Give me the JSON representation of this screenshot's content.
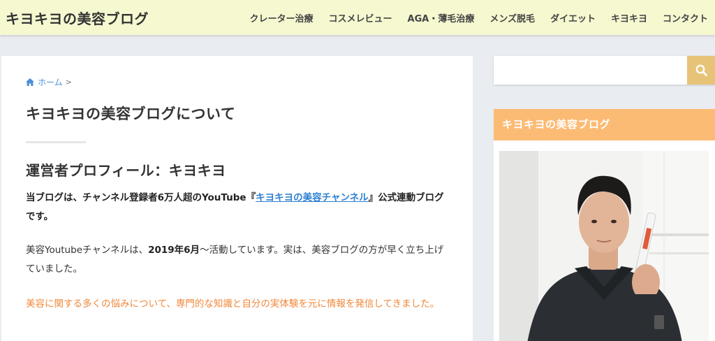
{
  "header": {
    "site_title": "キヨキヨの美容ブログ",
    "nav": [
      "クレーター治療",
      "コスメレビュー",
      "AGA・薄毛治療",
      "メンズ脱毛",
      "ダイエット",
      "キヨキヨ",
      "コンタクト"
    ]
  },
  "breadcrumb": {
    "home_label": "ホーム",
    "separator": ">",
    "icon": "home-icon"
  },
  "article": {
    "title": "キヨキヨの美容ブログについて",
    "profile_heading": "運営者プロフィール：キヨキヨ",
    "p1_before": "当ブログは、チャンネル登録者6万人超のYouTube『",
    "p1_link": "キヨキヨの美容チャンネル",
    "p1_after": "』公式連動ブログです。",
    "p2_before": "美容Youtubeチャンネルは、",
    "p2_bold": "2019年6月",
    "p2_after": "〜活動しています。実は、美容ブログの方が早く立ち上げていました。",
    "p3": "美容に関する多くの悩みについて、専門的な知識と自分の実体験を元に情報を発信してきました。"
  },
  "sidebar": {
    "search_placeholder": "",
    "search_icon": "search-icon",
    "widget_title": "キヨキヨの美容ブログ",
    "photo_icon": "profile-photo"
  },
  "colors": {
    "header_bg": "#f6f8d0",
    "page_bg": "#e9ecf1",
    "link": "#2f80d1",
    "accent_orange": "#f0883b",
    "widget_header": "#fcbb74",
    "search_button": "#e6c376"
  }
}
